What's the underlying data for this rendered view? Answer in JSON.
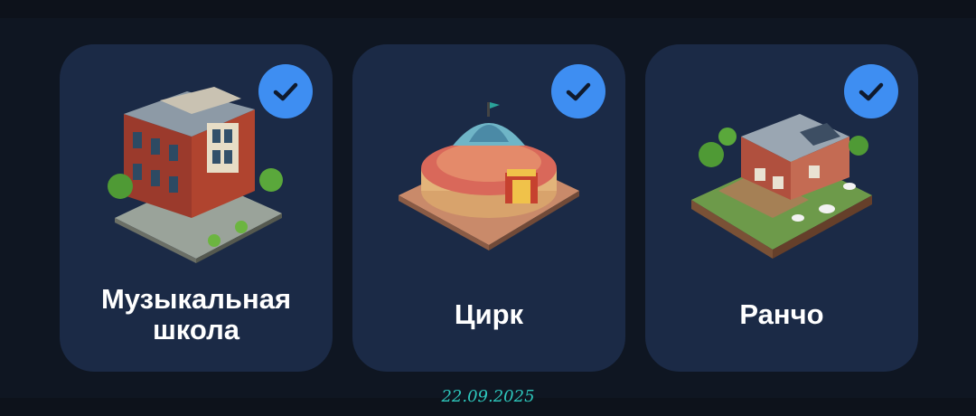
{
  "cards": [
    {
      "title": "Музыкальная школа",
      "selected": true,
      "image": "music-school-building"
    },
    {
      "title": "Цирк",
      "selected": true,
      "image": "circus-building"
    },
    {
      "title": "Ранчо",
      "selected": true,
      "image": "ranch-building"
    }
  ],
  "footer": {
    "date": "22.09.2025"
  },
  "colors": {
    "card": "#1b2a46",
    "check": "#3e8ef2",
    "date": "#2ec8bd",
    "background": "#0d121b"
  }
}
